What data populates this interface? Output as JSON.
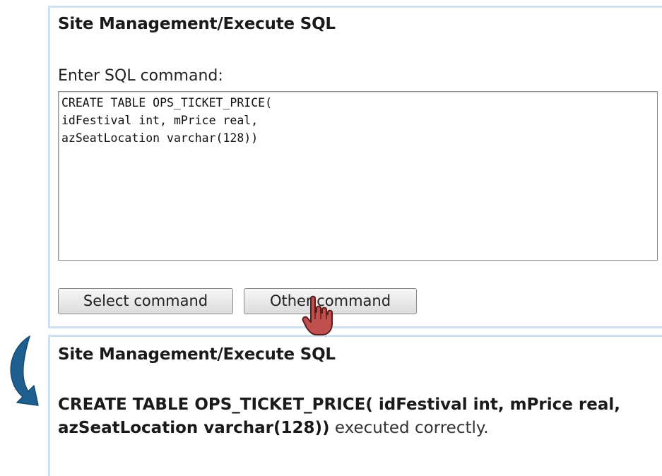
{
  "top_panel": {
    "title": "Site Management/Execute SQL",
    "prompt_label": "Enter SQL command:",
    "sql_value": "CREATE TABLE OPS_TICKET_PRICE(\nidFestival int, mPrice real,\nazSeatLocation varchar(128))",
    "select_button": "Select command",
    "other_button": "Other command"
  },
  "bottom_panel": {
    "title": "Site Management/Execute SQL",
    "result_statement": "CREATE TABLE OPS_TICKET_PRICE( idFestival int, mPrice real, azSeatLocation varchar(128))",
    "result_suffix": " executed correctly."
  },
  "icons": {
    "pointer": "hand-pointer-icon",
    "transition": "curved-arrow-icon"
  },
  "colors": {
    "panel_border": "#cfe0f0",
    "arrow": "#1f5f8f",
    "hand": "#c0504d"
  }
}
